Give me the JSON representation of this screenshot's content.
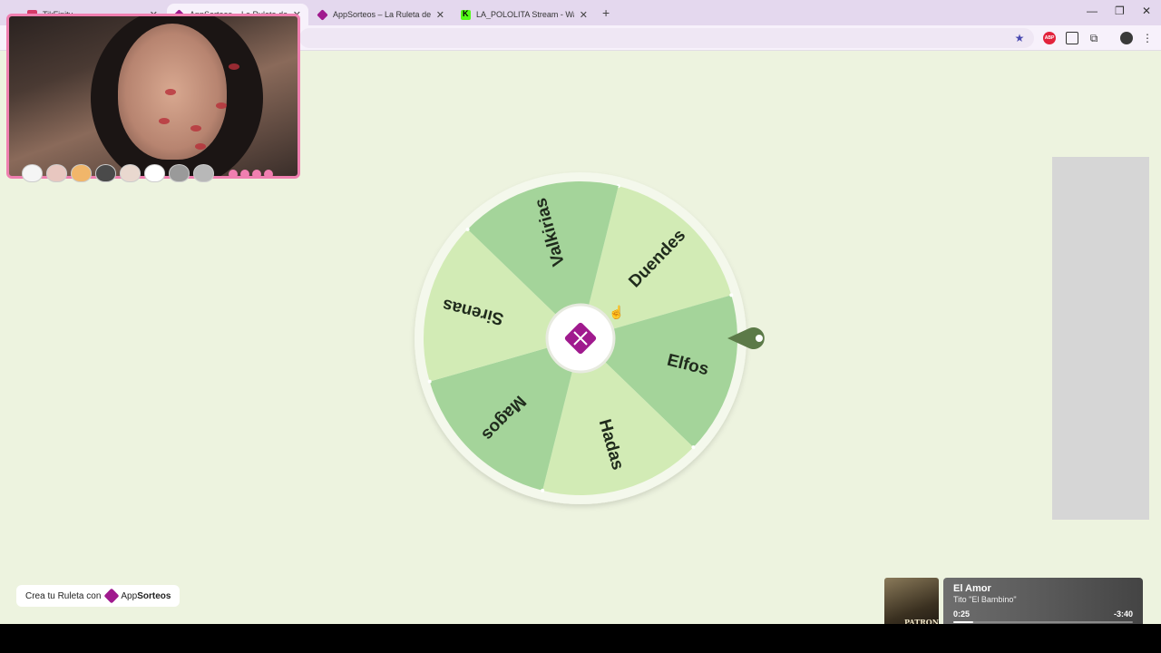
{
  "browser": {
    "tabs": [
      {
        "title": "TikFinity",
        "favicon": "tikfinity-icon",
        "active": false
      },
      {
        "title": "AppSorteos – La Ruleta de la Suerte",
        "favicon": "appsorteos-icon",
        "active": true
      },
      {
        "title": "AppSorteos – La Ruleta de la Suerte",
        "favicon": "appsorteos-icon",
        "active": false
      },
      {
        "title": "LA_POLOLITA Stream - Watch Live on Kick",
        "favicon": "kick-icon",
        "active": false
      }
    ],
    "new_tab_label": "+",
    "close_label": "✕",
    "window_controls": {
      "minimize": "—",
      "maximize": "❐",
      "close": "✕"
    },
    "toolbar_icons": {
      "star": "★",
      "abp": "ABP",
      "ext": "⧉",
      "kebab": "⋮"
    }
  },
  "wheel": {
    "segments": [
      {
        "label": "Duendes",
        "color": "#d2ebb5"
      },
      {
        "label": "Valkirias",
        "color": "#a4d49a"
      },
      {
        "label": "Sirenas",
        "color": "#d2ebb5"
      },
      {
        "label": "Magos",
        "color": "#a4d49a"
      },
      {
        "label": "Hadas",
        "color": "#d2ebb5"
      },
      {
        "label": "Elfos",
        "color": "#a4d49a"
      }
    ],
    "rim_color": "#f4f8ec",
    "pointer_color": "#5c7a48",
    "center_logo_color": "#a01a8e"
  },
  "branding": {
    "prefix": "Crea tu Ruleta con",
    "app_light": "App",
    "app_bold": "Sorteos"
  },
  "now_playing": {
    "song": "El Amor",
    "artist": "Tito \"El Bambino\"",
    "elapsed": "0:25",
    "remaining": "-3:40",
    "progress": 0.11,
    "album_text": "PATRON"
  }
}
